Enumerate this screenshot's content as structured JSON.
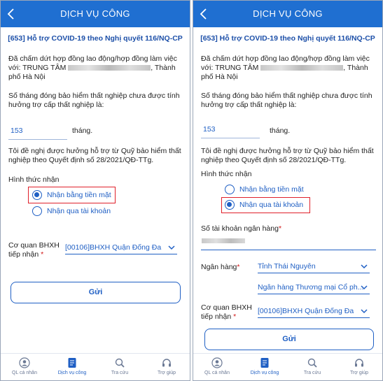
{
  "header": {
    "title": "DỊCH VỤ CÔNG"
  },
  "form": {
    "subtitle": "[653] Hỗ trợ COVID-19 theo Nghị quyết 116/NQ-CP",
    "termination_line1": "Đã chấm dứt hợp đồng  lao động/hợp đồng làm việc",
    "termination_prefix": "với: TRUNG TÂM",
    "termination_suffix": ", Thành",
    "termination_line3": "phố Hà Nội",
    "months_question_l1": "Số tháng đóng bảo hiểm thất nghiệp chưa được tính",
    "months_question_l2": "hưởng trợ cấp thất nghiệp là:",
    "months_value": "153",
    "months_unit": "tháng.",
    "request_l1": "Tôi đề nghị được hưởng hỗ trợ từ Quỹ bảo hiểm thất",
    "request_l2": "nghiệp theo Quyết định số 28/2021/QĐ-TTg.",
    "receive_method_label": "Hình thức nhận",
    "option_cash": "Nhận bằng tiền mặt",
    "option_account": "Nhận qua tài khoản",
    "account_number_label": "Số tài khoản ngân hàng",
    "bank_label": "Ngân hàng",
    "bank_province": "Tỉnh Thái Nguyên",
    "bank_name": "Ngân hàng Thương mại Cổ ph...",
    "agency_label_l1": "Cơ quan BHXH",
    "agency_label_l2": "tiếp nhận",
    "agency_value": "[00106]BHXH Quận Đống Đa",
    "required_mark": "*",
    "submit_label": "Gửi"
  },
  "screens": {
    "left": {
      "selected_option": "Nhận bằng tiền mặt"
    },
    "right": {
      "selected_option": "Nhận qua tài khoản"
    }
  },
  "bottom_nav": [
    {
      "label": "QL cá nhân",
      "icon": "personal-icon"
    },
    {
      "label": "Dịch vụ công",
      "icon": "document-icon",
      "active": true
    },
    {
      "label": "Tra cứu",
      "icon": "lookup-icon"
    },
    {
      "label": "Trợ giúp",
      "icon": "help-headset-icon"
    }
  ],
  "colors": {
    "primary": "#1f6fd1",
    "accent_text": "#1f5fc4",
    "highlight": "#e0202a"
  }
}
